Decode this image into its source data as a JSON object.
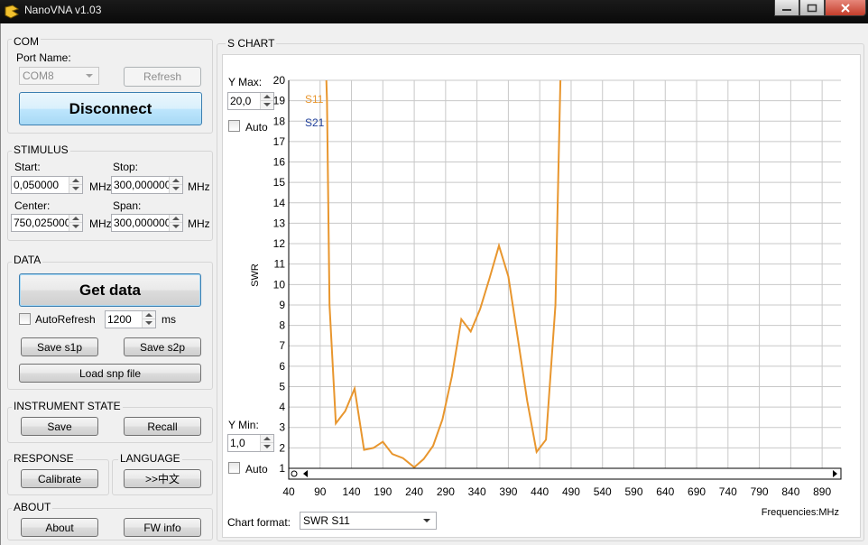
{
  "window": {
    "title": "NanoVNA v1.03"
  },
  "com": {
    "title": "COM",
    "port_label": "Port Name:",
    "port_value": "COM8",
    "refresh_label": "Refresh",
    "disconnect_label": "Disconnect"
  },
  "stimulus": {
    "title": "STIMULUS",
    "start_label": "Start:",
    "start_value": "0,050000",
    "stop_label": "Stop:",
    "stop_value": "300,000000",
    "center_label": "Center:",
    "center_value": "750,025000",
    "span_label": "Span:",
    "span_value": "300,000000",
    "unit": "MHz"
  },
  "data_group": {
    "title": "DATA",
    "get_data_label": "Get data",
    "autorefresh_label": "AutoRefresh",
    "interval_value": "1200",
    "interval_unit": "ms",
    "save_s1p_label": "Save s1p",
    "save_s2p_label": "Save s2p",
    "load_snp_label": "Load snp file"
  },
  "instrument_state": {
    "title": "INSTRUMENT STATE",
    "save_label": "Save",
    "recall_label": "Recall"
  },
  "response": {
    "title": "RESPONSE",
    "calibrate_label": "Calibrate"
  },
  "language": {
    "title": "LANGUAGE",
    "switch_label": ">>中文"
  },
  "about": {
    "title": "ABOUT",
    "about_label": "About",
    "fw_info_label": "FW info"
  },
  "chart_panel": {
    "title": "S CHART",
    "ymax_label": "Y Max:",
    "ymax_value": "20,0",
    "ymin_label": "Y Min:",
    "ymin_value": "1,0",
    "auto_label": "Auto",
    "format_label": "Chart format:",
    "format_value": "SWR S11"
  },
  "chart_data": {
    "type": "line",
    "ylabel": "SWR",
    "xlabel": "Frequencies:MHz",
    "ylim": [
      1,
      20
    ],
    "xlim": [
      40,
      920
    ],
    "x_ticks": [
      40,
      90,
      140,
      190,
      240,
      290,
      340,
      390,
      440,
      490,
      540,
      590,
      640,
      690,
      740,
      790,
      840,
      890
    ],
    "y_ticks": [
      1,
      2,
      3,
      4,
      5,
      6,
      7,
      8,
      9,
      10,
      11,
      12,
      13,
      14,
      15,
      16,
      17,
      18,
      19,
      20
    ],
    "grid": true,
    "legend_position": "top-left",
    "series": [
      {
        "name": "S11",
        "color": "#e8962e",
        "x": [
          100,
          101,
          105,
          115,
          130,
          145,
          160,
          175,
          190,
          205,
          222,
          240,
          255,
          270,
          285,
          300,
          315,
          330,
          345,
          360,
          375,
          390,
          405,
          420,
          435,
          450,
          465,
          473
        ],
        "y": [
          20,
          19,
          9,
          3.2,
          3.8,
          4.9,
          1.9,
          2.0,
          2.3,
          1.7,
          1.5,
          1.05,
          1.45,
          2.1,
          3.4,
          5.5,
          8.3,
          7.7,
          8.8,
          10.3,
          11.9,
          10.4,
          7.4,
          4.3,
          1.8,
          2.4,
          9,
          20
        ]
      },
      {
        "name": "S21",
        "color": "#1f3f9a",
        "x": [],
        "y": []
      }
    ]
  }
}
